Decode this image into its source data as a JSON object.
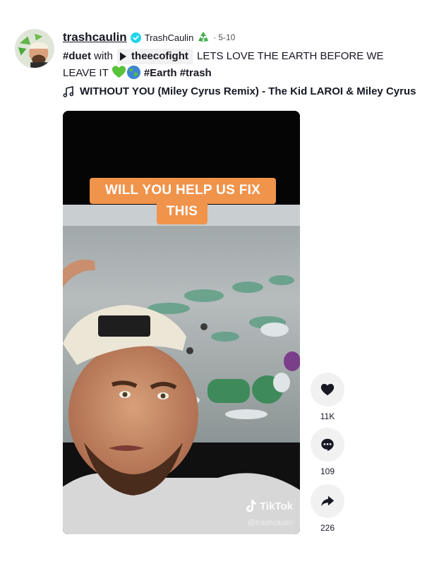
{
  "post": {
    "username": "trashcaulin",
    "nickname": "TrashCaulin",
    "separator": "·",
    "date": "5-10"
  },
  "description": {
    "duet_tag": "#duet",
    "with_text": " with ",
    "duet_user": "theecofight",
    "text": " LETS LOVE THE EARTH BEFORE WE LEAVE IT ",
    "tag_earth": "#Earth",
    "tag_trash": "#trash"
  },
  "music": {
    "title": "WITHOUT YOU (Miley Cyrus Remix) - The Kid LAROI & Miley Cyrus"
  },
  "video": {
    "caption_line1": "WILL YOU HELP US FIX",
    "caption_line2": "THIS",
    "watermark_brand": "TikTok",
    "watermark_handle": "@trashcaulin",
    "caption_color": "#f0934b"
  },
  "actions": {
    "likes": "11K",
    "comments": "109",
    "shares": "226"
  },
  "icons": {
    "verified": "verified-badge-icon",
    "recycle": "recycle-emoji-icon",
    "music": "music-note-icon",
    "like": "heart-icon",
    "comment": "comment-icon",
    "share": "share-arrow-icon"
  },
  "colors": {
    "verified": "#20d5ec",
    "text": "#161823",
    "muted": "#545454",
    "action_bg": "#f1f1f2"
  }
}
